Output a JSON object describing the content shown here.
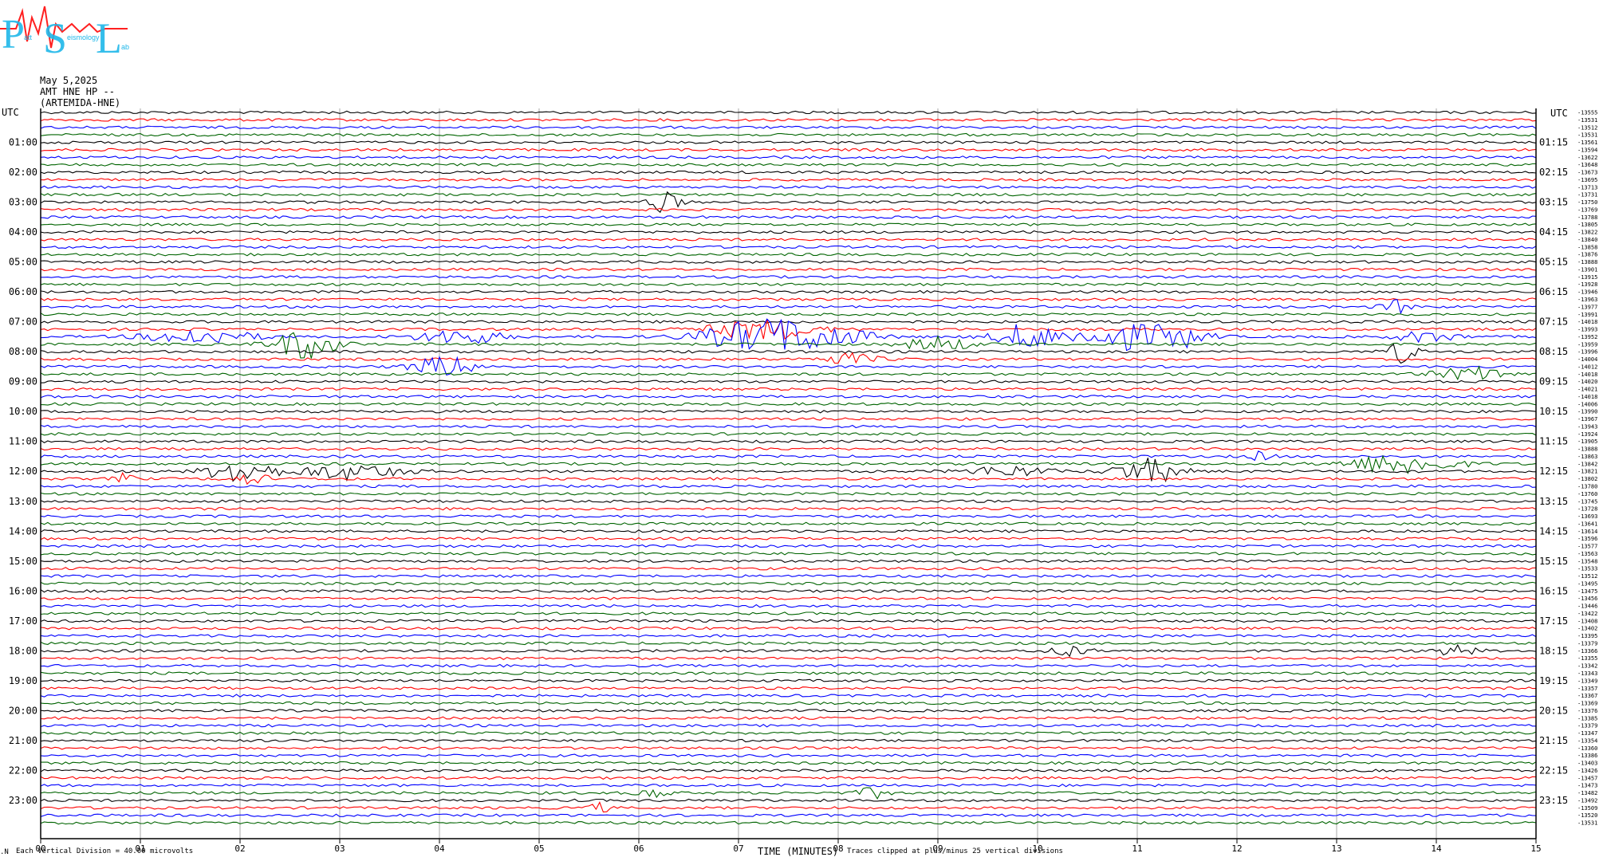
{
  "logo": {
    "letters": [
      "P",
      "S",
      "L"
    ],
    "small_text": [
      "att",
      "eismology",
      "ab"
    ],
    "name_hidden": "PSL"
  },
  "header": {
    "date": "May 5,2025",
    "station": "AMT HNE HP --",
    "station_name": "(ARTEMIDA-HNE)"
  },
  "left_axis_title": "UTC",
  "right_axis_title": "UTC",
  "footer": {
    "vertical_division_note": "Each Vertical Division =   40.00 microvolts",
    "xlabel": "TIME (MINUTES)",
    "clip_note": "Traces clipped at plus/minus 25 vertical divisions"
  },
  "colors": {
    "trace_cycle": [
      "#000000",
      "#ff0000",
      "#0000ff",
      "#006400"
    ],
    "grid": "#a9a9a9",
    "logo_blue": "#1fb7e9",
    "logo_red": "#ff2020"
  },
  "chart_data": {
    "type": "line",
    "title": "",
    "xlabel": "TIME (MINUTES)",
    "ylabel": "UTC",
    "x_ticks": [
      "00",
      "01",
      "02",
      "03",
      "04",
      "05",
      "06",
      "07",
      "08",
      "09",
      "10",
      "11",
      "12",
      "13",
      "14",
      "15"
    ],
    "xlim": [
      0,
      15
    ],
    "grid": true,
    "rows_per_hour": 4,
    "row_count": 96,
    "left_hour_labels": [
      "01:00",
      "02:00",
      "03:00",
      "04:00",
      "05:00",
      "06:00",
      "07:00",
      "08:00",
      "09:00",
      "10:00",
      "11:00",
      "12:00",
      "13:00",
      "14:00",
      "15:00",
      "16:00",
      "17:00",
      "18:00",
      "19:00",
      "20:00",
      "21:00",
      "22:00",
      "23:00"
    ],
    "right_hour_labels": [
      "01:15",
      "02:15",
      "03:15",
      "04:15",
      "05:15",
      "06:15",
      "07:15",
      "08:15",
      "09:15",
      "10:15",
      "11:15",
      "12:15",
      "13:15",
      "14:15",
      "15:15",
      "16:15",
      "17:15",
      "18:15",
      "19:15",
      "20:15",
      "21:15",
      "22:15",
      "23:15"
    ],
    "row_means": [
      -13555,
      -13531,
      -13512,
      -13531,
      -13561,
      -13594,
      -13622,
      -13648,
      -13673,
      -13695,
      -13713,
      -13731,
      -13750,
      -13769,
      -13788,
      -13805,
      -13822,
      -13840,
      -13858,
      -13876,
      -13888,
      -13901,
      -13915,
      -13928,
      -13946,
      -13963,
      -13977,
      -13991,
      -14018,
      -13993,
      -13952,
      -13959,
      -13996,
      -14004,
      -14012,
      -14018,
      -14020,
      -14021,
      -14018,
      -14006,
      -13990,
      -13967,
      -13943,
      -13924,
      -13905,
      -13888,
      -13863,
      -13842,
      -13821,
      -13802,
      -13780,
      -13760,
      -13745,
      -13728,
      -13693,
      -13641,
      -13614,
      -13596,
      -13577,
      -13563,
      -13548,
      -13533,
      -13512,
      -13495,
      -13475,
      -13456,
      -13446,
      -13422,
      -13408,
      -13402,
      -13395,
      -13379,
      -13366,
      -13355,
      -13342,
      -13343,
      -13349,
      -13357,
      -13367,
      -13369,
      -13376,
      -13385,
      -13379,
      -13347,
      -13354,
      -13360,
      -13386,
      -13403,
      -13426,
      -13457,
      -13473,
      -13482,
      -13492,
      -13509,
      -13520,
      -13531
    ],
    "events": [
      {
        "row": 12,
        "t": 6.25,
        "w": 0.15,
        "amp": 4
      },
      {
        "row": 26,
        "t": 13.6,
        "w": 0.15,
        "amp": 2.5
      },
      {
        "row": 29,
        "t": 7.25,
        "w": 0.5,
        "amp": 4
      },
      {
        "row": 30,
        "t": 1.6,
        "w": 0.5,
        "amp": 3
      },
      {
        "row": 30,
        "t": 4.2,
        "w": 0.4,
        "amp": 3
      },
      {
        "row": 30,
        "t": 7.3,
        "w": 0.6,
        "amp": 7
      },
      {
        "row": 30,
        "t": 8.0,
        "w": 0.4,
        "amp": 2
      },
      {
        "row": 30,
        "t": 9.9,
        "w": 0.3,
        "amp": 5
      },
      {
        "row": 30,
        "t": 10.8,
        "w": 0.4,
        "amp": 5
      },
      {
        "row": 30,
        "t": 11.4,
        "w": 0.3,
        "amp": 4
      },
      {
        "row": 30,
        "t": 13.9,
        "w": 0.3,
        "amp": 2
      },
      {
        "row": 31,
        "t": 2.65,
        "w": 0.3,
        "amp": 6
      },
      {
        "row": 31,
        "t": 9.0,
        "w": 0.3,
        "amp": 3
      },
      {
        "row": 32,
        "t": 13.65,
        "w": 0.15,
        "amp": 4
      },
      {
        "row": 33,
        "t": 8.1,
        "w": 0.3,
        "amp": 2
      },
      {
        "row": 34,
        "t": 4.05,
        "w": 0.3,
        "amp": 4
      },
      {
        "row": 35,
        "t": 14.4,
        "w": 0.4,
        "amp": 2.5
      },
      {
        "row": 46,
        "t": 12.25,
        "w": 0.1,
        "amp": 2
      },
      {
        "row": 47,
        "t": 13.65,
        "w": 0.5,
        "amp": 4
      },
      {
        "row": 48,
        "t": 2.0,
        "w": 0.3,
        "amp": 5
      },
      {
        "row": 48,
        "t": 3.1,
        "w": 0.5,
        "amp": 3
      },
      {
        "row": 48,
        "t": 9.7,
        "w": 0.4,
        "amp": 2
      },
      {
        "row": 48,
        "t": 11.1,
        "w": 0.3,
        "amp": 5
      },
      {
        "row": 49,
        "t": 0.85,
        "w": 0.1,
        "amp": 2
      },
      {
        "row": 49,
        "t": 2.1,
        "w": 0.2,
        "amp": 2
      },
      {
        "row": 72,
        "t": 10.3,
        "w": 0.2,
        "amp": 2
      },
      {
        "row": 72,
        "t": 14.2,
        "w": 0.2,
        "amp": 2
      },
      {
        "row": 91,
        "t": 6.15,
        "w": 0.15,
        "amp": 2
      },
      {
        "row": 91,
        "t": 8.35,
        "w": 0.15,
        "amp": 2
      },
      {
        "row": 93,
        "t": 5.6,
        "w": 0.1,
        "amp": 2
      }
    ]
  }
}
